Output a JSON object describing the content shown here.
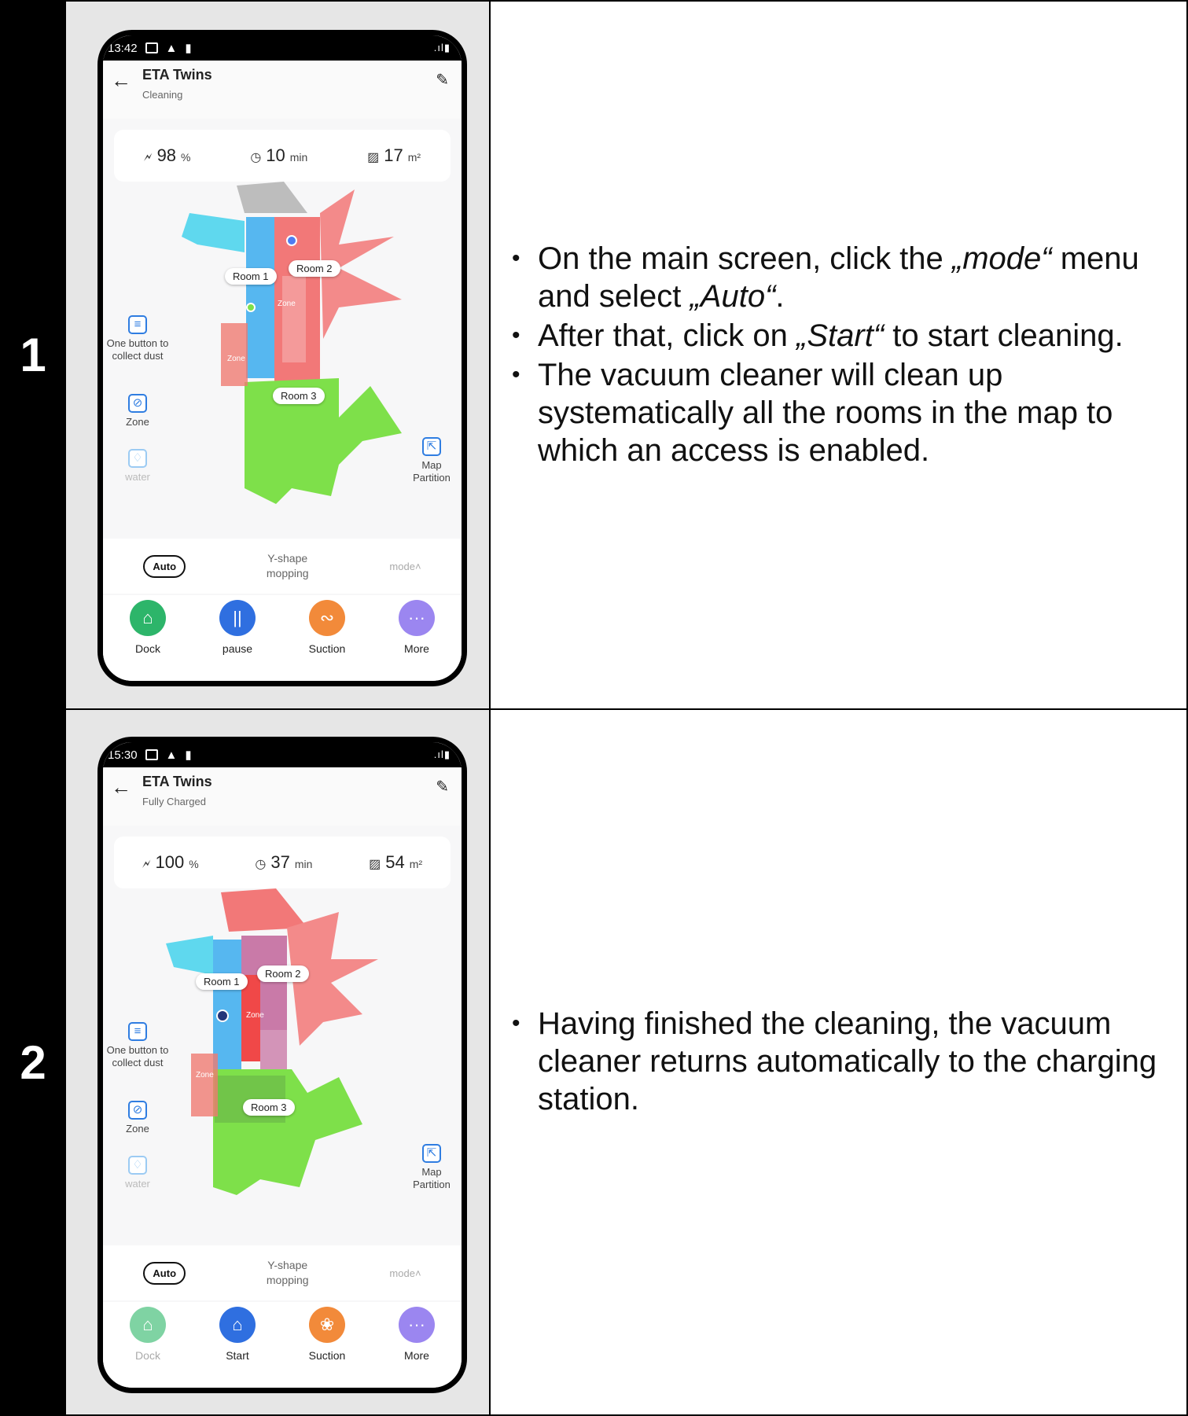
{
  "steps": [
    {
      "number": "1",
      "bullets": [
        [
          "On the main screen, click the ",
          "„mode“",
          " menu and select ",
          "„Auto“",
          "."
        ],
        [
          "After that, click on ",
          "„Start“",
          " to start cleaning.",
          "",
          ""
        ],
        [
          "The vacuum cleaner will clean up systematically all the rooms in the map to which an access is enabled.",
          "",
          "",
          "",
          ""
        ]
      ],
      "phone": {
        "time": "13:42",
        "title": "ETA Twins",
        "status": "Cleaning",
        "battery": "98",
        "battery_unit": "%",
        "duration": "10",
        "duration_unit": "min",
        "area": "17",
        "area_unit": "m²",
        "rooms": [
          "Room 1",
          "Room 2",
          "Room 3"
        ],
        "zone": "Zone",
        "side": {
          "dust": "One button to collect dust",
          "zone": "Zone",
          "water": "water",
          "map_partition": "Map Partition"
        },
        "mode": {
          "auto": "Auto",
          "yshape_1": "Y-shape",
          "yshape_2": "mopping",
          "mode": "mode˄"
        },
        "actions": [
          {
            "label": "Dock",
            "icon": "⌂",
            "color": "#2db56a"
          },
          {
            "label": "pause",
            "icon": "||",
            "color": "#2f6fe0"
          },
          {
            "label": "Suction",
            "icon": "ᔓ",
            "color": "#f28a3a"
          },
          {
            "label": "More",
            "icon": "···",
            "color": "#9b86f0"
          }
        ]
      }
    },
    {
      "number": "2",
      "bullets": [
        [
          "Having finished the cleaning, the vacuum cleaner returns automatically to the charging station.",
          "",
          "",
          "",
          ""
        ]
      ],
      "phone": {
        "time": "15:30",
        "title": "ETA Twins",
        "status": "Fully Charged",
        "battery": "100",
        "battery_unit": "%",
        "duration": "37",
        "duration_unit": "min",
        "area": "54",
        "area_unit": "m²",
        "rooms": [
          "Room 1",
          "Room 2",
          "Room 3"
        ],
        "zone": "Zone",
        "side": {
          "dust": "One button to collect dust",
          "zone": "Zone",
          "water": "water",
          "map_partition": "Map Partition"
        },
        "mode": {
          "auto": "Auto",
          "yshape_1": "Y-shape",
          "yshape_2": "mopping",
          "mode": "mode˄"
        },
        "actions": [
          {
            "label": "Dock",
            "icon": "⌂",
            "color": "#7fd3a3"
          },
          {
            "label": "Start",
            "icon": "⌂",
            "color": "#2f6fe0"
          },
          {
            "label": "Suction",
            "icon": "❀",
            "color": "#f28a3a"
          },
          {
            "label": "More",
            "icon": "···",
            "color": "#9b86f0"
          }
        ]
      }
    }
  ]
}
